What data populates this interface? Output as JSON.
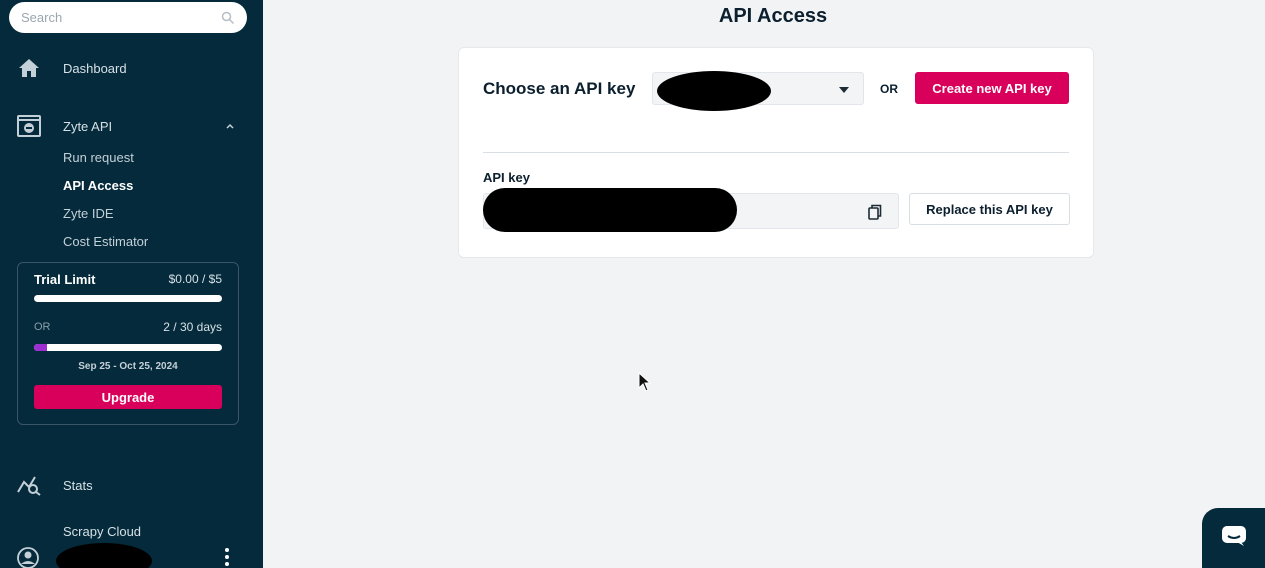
{
  "sidebar": {
    "search": {
      "placeholder": "Search"
    },
    "items": [
      {
        "label": "Dashboard",
        "icon": "home-icon"
      },
      {
        "label": "Zyte API",
        "icon": "zyte-api-icon"
      },
      {
        "label": "Stats",
        "icon": "stats-icon"
      }
    ],
    "sub_items": [
      "Run request",
      "API Access",
      "Zyte IDE",
      "Cost Estimator"
    ],
    "active_sub_item": "API Access",
    "trial": {
      "title": "Trial Limit",
      "amount": "$0.00 / $5",
      "spend_progress": 0,
      "or_label": "OR",
      "days": "2 / 30 days",
      "days_progress": 0.067,
      "dates": "Sep 25 - Oct 25, 2024",
      "upgrade_label": "Upgrade"
    },
    "cut_off_item": "Scrapy Cloud"
  },
  "main": {
    "title": "API Access",
    "choose_label": "Choose an API key",
    "or_text": "OR",
    "create_label": "Create new API key",
    "api_key_label": "API key",
    "replace_label": "Replace this API key"
  },
  "colors": {
    "sidebar_bg": "#052a3b",
    "accent": "#d9005b",
    "progress": "#9b2fd0",
    "page_bg": "#f2f3f5"
  }
}
